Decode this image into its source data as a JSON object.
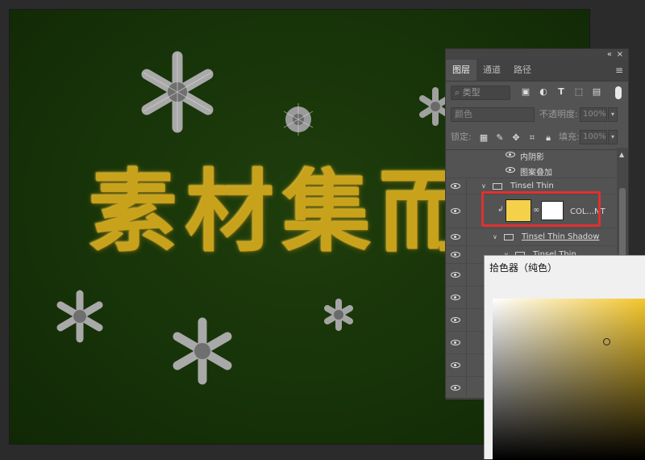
{
  "canvas": {
    "headline_text": "素材集而",
    "background_color": "#173309",
    "glitter_gold": "#c9a21b",
    "glitter_silver": "#a8a8a8"
  },
  "layers_panel": {
    "window_controls": {
      "collapse": "«",
      "close": "×"
    },
    "tabs": [
      {
        "label": "图层",
        "active": true
      },
      {
        "label": "通道",
        "active": false
      },
      {
        "label": "路径",
        "active": false
      }
    ],
    "filter": {
      "placeholder": "类型",
      "icon": "search-icon"
    },
    "filter_icons": [
      "image-filter-icon",
      "adjustment-filter-icon",
      "type-filter-icon",
      "shape-filter-icon",
      "smart-object-filter-icon"
    ],
    "blend_mode": "颜色",
    "opacity": {
      "label": "不透明度:",
      "value": "100%"
    },
    "lock": {
      "label": "锁定:"
    },
    "fill": {
      "label": "填充:",
      "value": "100%"
    },
    "layers": [
      {
        "name": "内阴影",
        "kind": "effect"
      },
      {
        "name": "图案叠加",
        "kind": "effect"
      },
      {
        "name": "Tinsel Thin",
        "kind": "group"
      },
      {
        "name": "COL...NT",
        "kind": "fill-layer",
        "thumb_color": "#f5d14a"
      },
      {
        "name": "Tinsel Thin Shadow",
        "kind": "group"
      },
      {
        "name": "Tinsel Thin",
        "kind": "group"
      }
    ]
  },
  "color_picker": {
    "title": "拾色器（纯色）",
    "hue_color": "#f3c62a"
  },
  "colors": {
    "highlight": "#e03030",
    "panel_bg": "#535353"
  }
}
